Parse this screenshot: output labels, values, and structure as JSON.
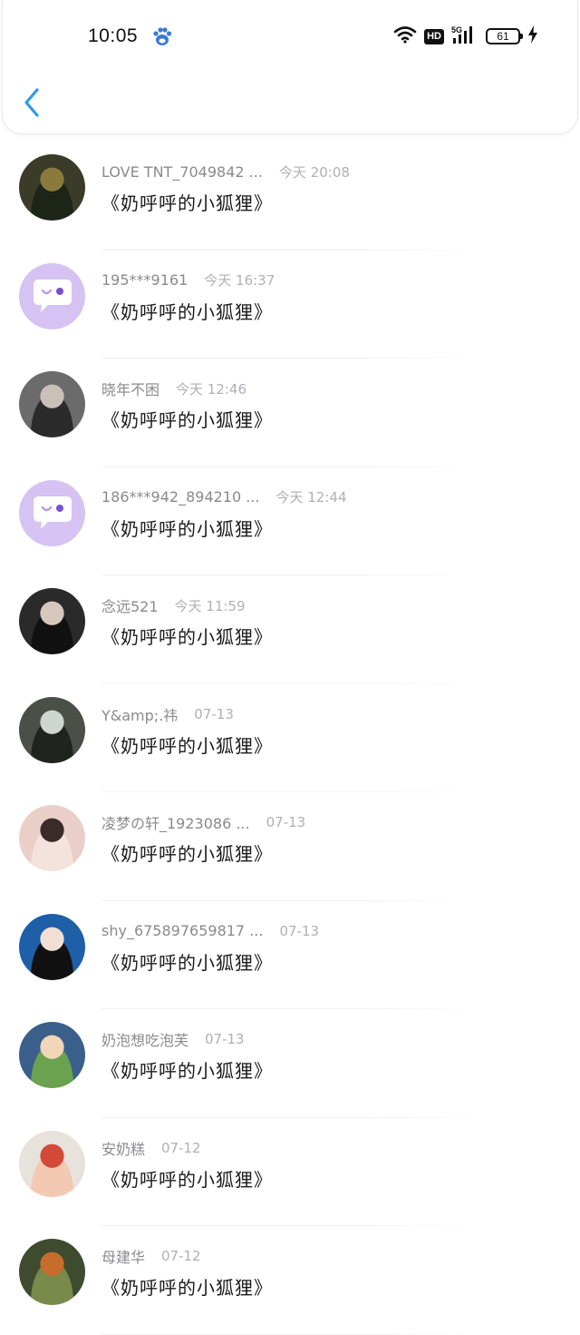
{
  "status_bar": {
    "time": "10:05",
    "network_badge": "HD",
    "network_type": "5G",
    "battery": "61"
  },
  "colors": {
    "accent": "#2f9be8",
    "bot_avatar_bg": "#d6c2f3",
    "bot_avatar_fg": "#ffffff",
    "name_text": "#8a8a8f",
    "date_text": "#b0b0b5"
  },
  "messages": [
    {
      "name": "LOVE TNT_7049842 ...",
      "date": "今天 20:08",
      "text": "《奶呼呼的小狐狸》",
      "avatar": "photo-stadium"
    },
    {
      "name": "195***9161",
      "date": "今天 16:37",
      "text": "《奶呼呼的小狐狸》",
      "avatar": "chat-bot-icon"
    },
    {
      "name": "晓年不困",
      "date": "今天 12:46",
      "text": "《奶呼呼的小狐狸》",
      "avatar": "photo-portrait"
    },
    {
      "name": "186***942_894210 ...",
      "date": "今天 12:44",
      "text": "《奶呼呼的小狐狸》",
      "avatar": "chat-bot-icon"
    },
    {
      "name": "念远521",
      "date": "今天 11:59",
      "text": "《奶呼呼的小狐狸》",
      "avatar": "photo-portrait"
    },
    {
      "name": "Y&amp;.祎",
      "date": "07-13",
      "text": "《奶呼呼的小狐狸》",
      "avatar": "photo-portrait"
    },
    {
      "name": "凌梦の轩_1923086 ...",
      "date": "07-13",
      "text": "《奶呼呼的小狐狸》",
      "avatar": "photo-portrait"
    },
    {
      "name": "shy_675897659817 ...",
      "date": "07-13",
      "text": "《奶呼呼的小狐狸》",
      "avatar": "photo-portrait"
    },
    {
      "name": "奶泡想吃泡芙",
      "date": "07-13",
      "text": "《奶呼呼的小狐狸》",
      "avatar": "photo-cartoon"
    },
    {
      "name": "安奶糕",
      "date": "07-12",
      "text": "《奶呼呼的小狐狸》",
      "avatar": "photo-portrait"
    },
    {
      "name": "母建华",
      "date": "07-12",
      "text": "《奶呼呼的小狐狸》",
      "avatar": "photo-portrait"
    }
  ]
}
